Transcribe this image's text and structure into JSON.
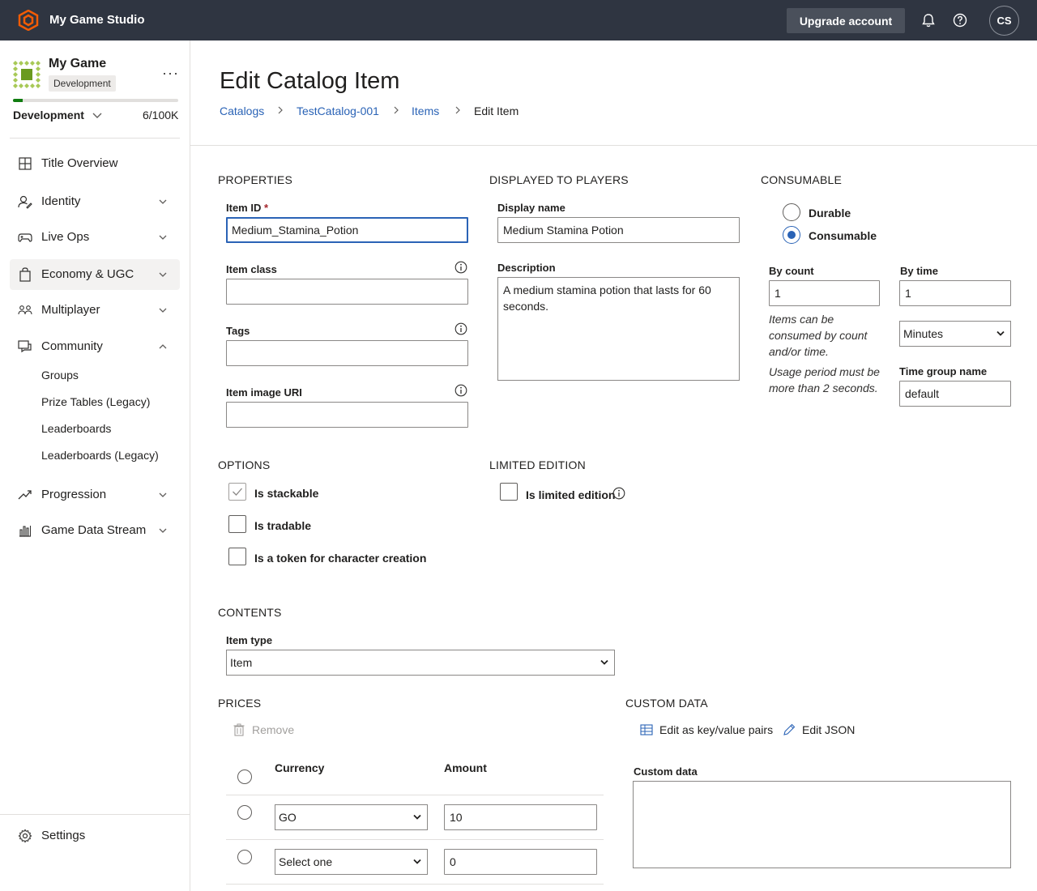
{
  "topbar": {
    "studio_name": "My Game Studio",
    "upgrade_label": "Upgrade account",
    "avatar_initials": "CS"
  },
  "sidebar": {
    "game_name": "My Game",
    "environment_badge": "Development",
    "environment": "Development",
    "usage": "6/100K",
    "usage_fraction": 0.06,
    "nav": [
      {
        "label": "Title Overview",
        "icon": "grid-icon"
      },
      {
        "label": "Identity",
        "icon": "identity-icon"
      },
      {
        "label": "Live Ops",
        "icon": "gamepad-icon"
      },
      {
        "label": "Economy & UGC",
        "icon": "shopping-bag-icon"
      },
      {
        "label": "Multiplayer",
        "icon": "people-icon"
      },
      {
        "label": "Community",
        "icon": "chat-icon"
      },
      {
        "label": "Progression",
        "icon": "trend-icon"
      },
      {
        "label": "Game Data Stream",
        "icon": "bar-chart-icon"
      }
    ],
    "community_sub": [
      "Groups",
      "Prize Tables (Legacy)",
      "Leaderboards",
      "Leaderboards (Legacy)"
    ],
    "settings_label": "Settings"
  },
  "page": {
    "title": "Edit Catalog Item",
    "breadcrumb": [
      "Catalogs",
      "TestCatalog-001",
      "Items",
      "Edit Item"
    ]
  },
  "properties": {
    "heading": "PROPERTIES",
    "item_id_label": "Item ID",
    "required_mark": "*",
    "item_id_value": "Medium_Stamina_Potion",
    "item_class_label": "Item class",
    "tags_label": "Tags",
    "image_uri_label": "Item image URI"
  },
  "displayed": {
    "heading": "DISPLAYED TO PLAYERS",
    "display_name_label": "Display name",
    "display_name_value": "Medium Stamina Potion",
    "description_label": "Description",
    "description_value": "A medium stamina potion that lasts for 60 seconds."
  },
  "consumable": {
    "heading": "CONSUMABLE",
    "durable_label": "Durable",
    "consumable_label": "Consumable",
    "selected": "Consumable",
    "by_count_label": "By count",
    "by_count_value": "1",
    "by_time_label": "By time",
    "by_time_value": "1",
    "time_unit": "Minutes",
    "hint1": "Items can be consumed by count and/or time.",
    "hint2": "Usage period must be more than 2 seconds.",
    "time_group_label": "Time group name",
    "time_group_value": "default"
  },
  "options": {
    "heading": "OPTIONS",
    "stackable_label": "Is stackable",
    "stackable": true,
    "tradable_label": "Is tradable",
    "tradable": false,
    "token_label": "Is a token for character creation",
    "token": false
  },
  "limited": {
    "heading": "LIMITED EDITION",
    "label": "Is limited edition",
    "checked": false
  },
  "contents": {
    "heading": "CONTENTS",
    "item_type_label": "Item type",
    "item_type_value": "Item"
  },
  "prices": {
    "heading": "PRICES",
    "remove_label": "Remove",
    "currency_header": "Currency",
    "amount_header": "Amount",
    "rows": [
      {
        "currency": "GO",
        "amount": "10"
      },
      {
        "currency": "Select one",
        "amount": "0"
      }
    ]
  },
  "custom_data": {
    "heading": "CUSTOM DATA",
    "edit_kv_label": "Edit as key/value pairs",
    "edit_json_label": "Edit JSON",
    "label": "Custom data",
    "value": ""
  }
}
